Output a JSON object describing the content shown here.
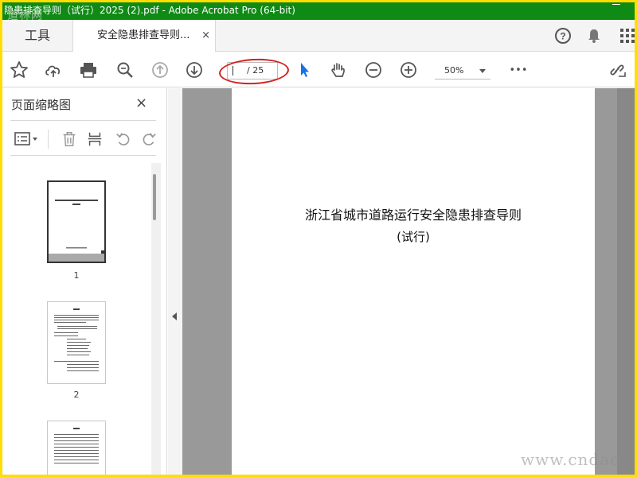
{
  "window": {
    "title": "隐患排查导则（试行）2025 (2).pdf - Adobe Acrobat Pro (64-bit)"
  },
  "watermark": {
    "logo": "道林网",
    "url": "www.cndac"
  },
  "tabs": {
    "tools_label": "工具",
    "doc_label": "安全隐患排查导则...",
    "close_symbol": "×"
  },
  "header_icons": [
    "help-icon",
    "bell-icon",
    "apps-grid-icon"
  ],
  "toolbar": {
    "icons": [
      "star-icon",
      "upload-cloud-icon",
      "print-icon",
      "search-zoom-icon",
      "page-up-icon",
      "page-down-icon",
      "select-cursor-icon",
      "hand-icon",
      "zoom-out-icon",
      "zoom-in-icon",
      "more-icon",
      "share-link-icon"
    ],
    "page_current": "",
    "page_total": "/ 25",
    "zoom_value": "50%",
    "more_label": "•••"
  },
  "sidebar": {
    "title": "页面缩略图",
    "close_symbol": "×",
    "tools": [
      "page-options-icon",
      "delete-icon",
      "insert-page-icon",
      "rotate-left-icon",
      "rotate-right-icon"
    ],
    "thumbnails": [
      {
        "label": "1",
        "selected": true
      },
      {
        "label": "2",
        "selected": false
      },
      {
        "label": "",
        "selected": false
      }
    ]
  },
  "document": {
    "title": "浙江省城市道路运行安全隐患排查导则",
    "subtitle": "(试行)"
  },
  "colors": {
    "titlebar": "#0f8a15",
    "frame": "#ffde00",
    "annotation": "#d42020",
    "select_tool": "#1473e6",
    "viewer_bg": "#999999"
  }
}
